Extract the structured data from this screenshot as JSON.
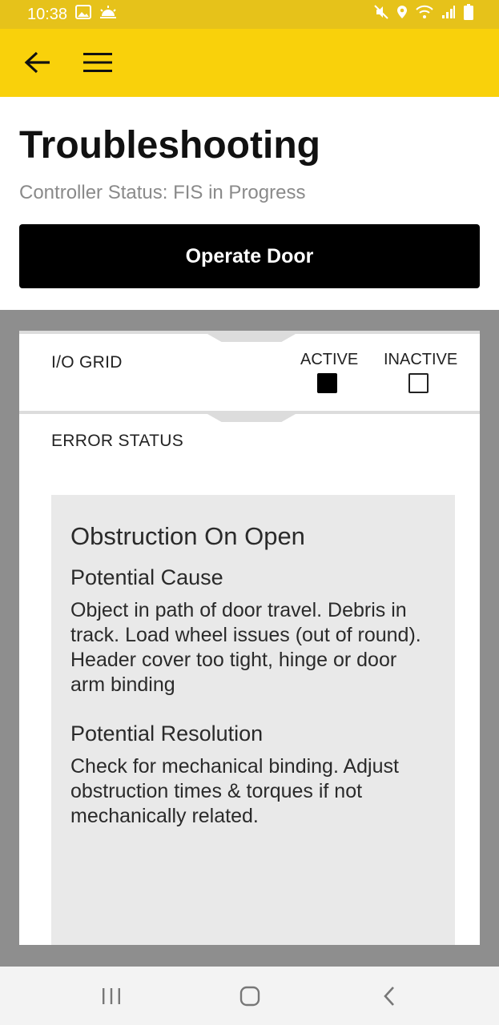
{
  "status_bar": {
    "time": "10:38"
  },
  "app_bar": {},
  "page": {
    "title": "Troubleshooting",
    "controller_status": "Controller Status: FIS in Progress",
    "operate_button": "Operate Door"
  },
  "io_grid": {
    "label": "I/O GRID",
    "legend_active": "ACTIVE",
    "legend_inactive": "INACTIVE"
  },
  "error_status": {
    "label": "ERROR STATUS",
    "title": "Obstruction On Open",
    "cause_heading": "Potential Cause",
    "cause_text": "Object in path of door travel. Debris in track. Load wheel issues (out of round). Header cover too tight, hinge or door arm binding",
    "resolution_heading": "Potential Resolution",
    "resolution_text": "Check for mechanical binding. Adjust obstruction times & torques if not mechanically related."
  },
  "colors": {
    "app_bar": "#f9d10b",
    "status_bar": "#e6c21a",
    "button": "#000000",
    "panel_bg": "#e9e9e9",
    "outer_bg": "#8e8e8e"
  }
}
